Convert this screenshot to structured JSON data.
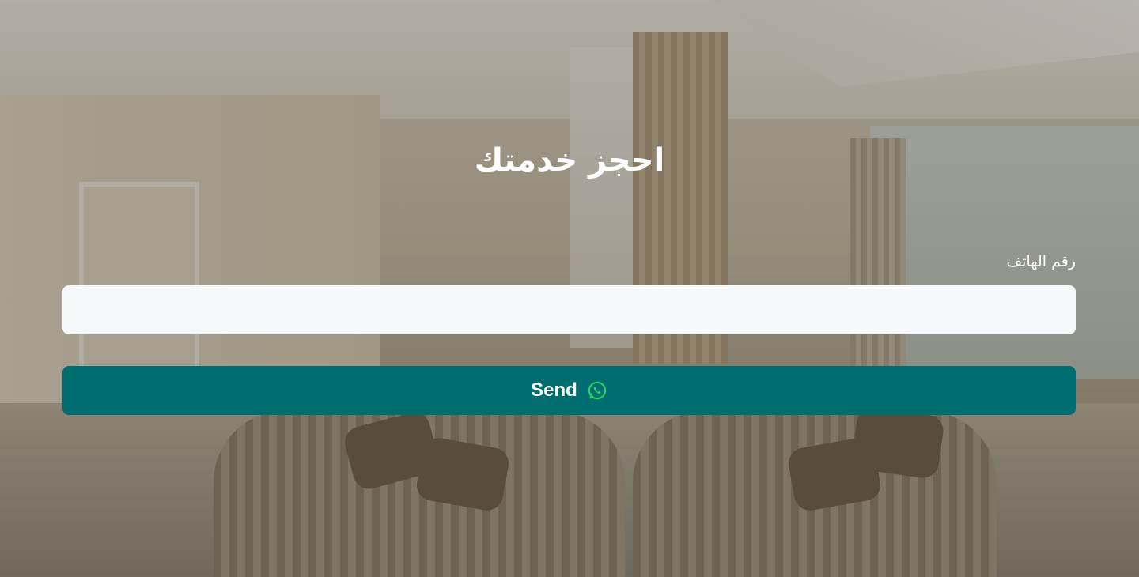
{
  "form": {
    "title": "احجز خدمتك",
    "phone_label": "رقم الهاتف",
    "phone_value": "",
    "phone_placeholder": "",
    "send_label": "Send",
    "send_icon": "whatsapp-icon"
  },
  "colors": {
    "button_bg": "#006e70",
    "input_bg": "#f7f8f9",
    "text": "#ffffff",
    "icon": "#25d366"
  }
}
